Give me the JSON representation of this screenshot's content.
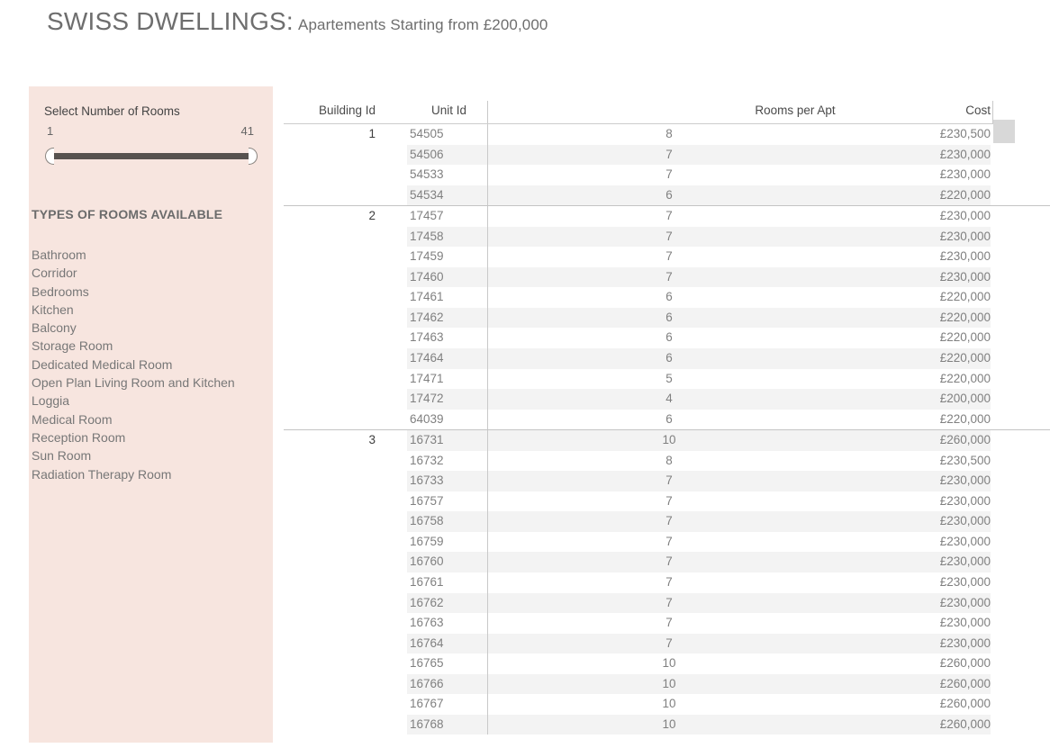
{
  "header": {
    "title_main": "SWISS DWELLINGS:",
    "title_sub": "Apartements Starting from £200,000"
  },
  "sidebar": {
    "filter_label": "Select Number of Rooms",
    "slider": {
      "min": "1",
      "max": "41",
      "handle_left_name": "slider-handle-left",
      "handle_right_name": "slider-handle-right"
    },
    "room_types_heading": "TYPES OF ROOMS AVAILABLE",
    "room_types": [
      "Bathroom",
      "Corridor",
      "Bedrooms",
      "Kitchen",
      "Balcony",
      "Storage Room",
      "Dedicated Medical Room",
      "Open Plan Living Room and Kitchen",
      "Loggia",
      "Medical Room",
      "Reception Room",
      "Sun Room",
      "Radiation Therapy Room"
    ],
    "background_color": "#f7e5df"
  },
  "table": {
    "columns": [
      "Building Id",
      "Unit Id",
      "Rooms per Apt",
      "Cost"
    ],
    "groups": [
      {
        "building_id": "1",
        "rows": [
          {
            "unit_id": "54505",
            "rooms": "8",
            "cost": "£230,500"
          },
          {
            "unit_id": "54506",
            "rooms": "7",
            "cost": "£230,000"
          },
          {
            "unit_id": "54533",
            "rooms": "7",
            "cost": "£230,000"
          },
          {
            "unit_id": "54534",
            "rooms": "6",
            "cost": "£220,000"
          }
        ]
      },
      {
        "building_id": "2",
        "rows": [
          {
            "unit_id": "17457",
            "rooms": "7",
            "cost": "£230,000"
          },
          {
            "unit_id": "17458",
            "rooms": "7",
            "cost": "£230,000"
          },
          {
            "unit_id": "17459",
            "rooms": "7",
            "cost": "£230,000"
          },
          {
            "unit_id": "17460",
            "rooms": "7",
            "cost": "£230,000"
          },
          {
            "unit_id": "17461",
            "rooms": "6",
            "cost": "£220,000"
          },
          {
            "unit_id": "17462",
            "rooms": "6",
            "cost": "£220,000"
          },
          {
            "unit_id": "17463",
            "rooms": "6",
            "cost": "£220,000"
          },
          {
            "unit_id": "17464",
            "rooms": "6",
            "cost": "£220,000"
          },
          {
            "unit_id": "17471",
            "rooms": "5",
            "cost": "£220,000"
          },
          {
            "unit_id": "17472",
            "rooms": "4",
            "cost": "£200,000"
          },
          {
            "unit_id": "64039",
            "rooms": "6",
            "cost": "£220,000"
          }
        ]
      },
      {
        "building_id": "3",
        "rows": [
          {
            "unit_id": "16731",
            "rooms": "10",
            "cost": "£260,000"
          },
          {
            "unit_id": "16732",
            "rooms": "8",
            "cost": "£230,500"
          },
          {
            "unit_id": "16733",
            "rooms": "7",
            "cost": "£230,000"
          },
          {
            "unit_id": "16757",
            "rooms": "7",
            "cost": "£230,000"
          },
          {
            "unit_id": "16758",
            "rooms": "7",
            "cost": "£230,000"
          },
          {
            "unit_id": "16759",
            "rooms": "7",
            "cost": "£230,000"
          },
          {
            "unit_id": "16760",
            "rooms": "7",
            "cost": "£230,000"
          },
          {
            "unit_id": "16761",
            "rooms": "7",
            "cost": "£230,000"
          },
          {
            "unit_id": "16762",
            "rooms": "7",
            "cost": "£230,000"
          },
          {
            "unit_id": "16763",
            "rooms": "7",
            "cost": "£230,000"
          },
          {
            "unit_id": "16764",
            "rooms": "7",
            "cost": "£230,000"
          },
          {
            "unit_id": "16765",
            "rooms": "10",
            "cost": "£260,000"
          },
          {
            "unit_id": "16766",
            "rooms": "10",
            "cost": "£260,000"
          },
          {
            "unit_id": "16767",
            "rooms": "10",
            "cost": "£260,000"
          },
          {
            "unit_id": "16768",
            "rooms": "10",
            "cost": "£260,000"
          }
        ]
      }
    ]
  },
  "scrollbar": {
    "thumb_color": "#d8d8d8"
  }
}
